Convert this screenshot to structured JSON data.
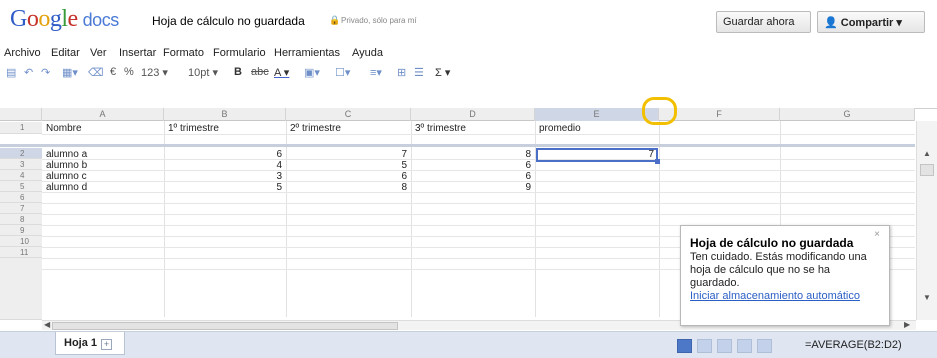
{
  "header": {
    "logo_letters": [
      "G",
      "o",
      "o",
      "g",
      "l",
      "e"
    ],
    "logo_suffix": "docs",
    "doc_title": "Hoja de cálculo no guardada",
    "privacy_text": "Privado, sólo para mí",
    "save_label": "Guardar ahora",
    "share_label": "Compartir ▾"
  },
  "menu": [
    "Archivo",
    "Editar",
    "Ver",
    "Insertar",
    "Formato",
    "Formulario",
    "Herramientas",
    "Ayuda"
  ],
  "toolbar": {
    "currency": "€",
    "percent": "%",
    "number_format": "123 ▾",
    "font_size": "10pt ▾",
    "bold": "B",
    "strike": "abc",
    "text_color": "A ▾",
    "sum": "Σ ▾"
  },
  "grid": {
    "columns": [
      "A",
      "B",
      "C",
      "D",
      "E",
      "F",
      "G"
    ],
    "rows": [
      "1",
      "2",
      "3",
      "4",
      "5",
      "6",
      "7",
      "8",
      "9",
      "10",
      "11"
    ],
    "selected_column": "E",
    "selected_row": "2",
    "cells": [
      [
        "Nombre",
        "1º trimestre",
        "2º trimestre",
        "3º trimestre",
        "promedio"
      ],
      [
        "alumno a",
        "6",
        "7",
        "8",
        "7"
      ],
      [
        "alumno b",
        "4",
        "5",
        "6",
        ""
      ],
      [
        "alumno c",
        "3",
        "6",
        "6",
        ""
      ],
      [
        "alumno d",
        "5",
        "8",
        "9",
        ""
      ]
    ]
  },
  "popup": {
    "title": "Hoja de cálculo no guardada",
    "body": "Ten cuidado. Estás modificando una hoja de cálculo que no se ha guardado.",
    "link": "Iniciar almacenamiento automático",
    "close": "×"
  },
  "bottom": {
    "sheet_tab": "Hoja 1",
    "add_sheet": "+",
    "formula": "=AVERAGE(B2:D2)"
  },
  "colors": {
    "accent": "#4b6fc7",
    "highlight_ring": "#f2c000",
    "bottom_bar": "#dfe6f1"
  }
}
